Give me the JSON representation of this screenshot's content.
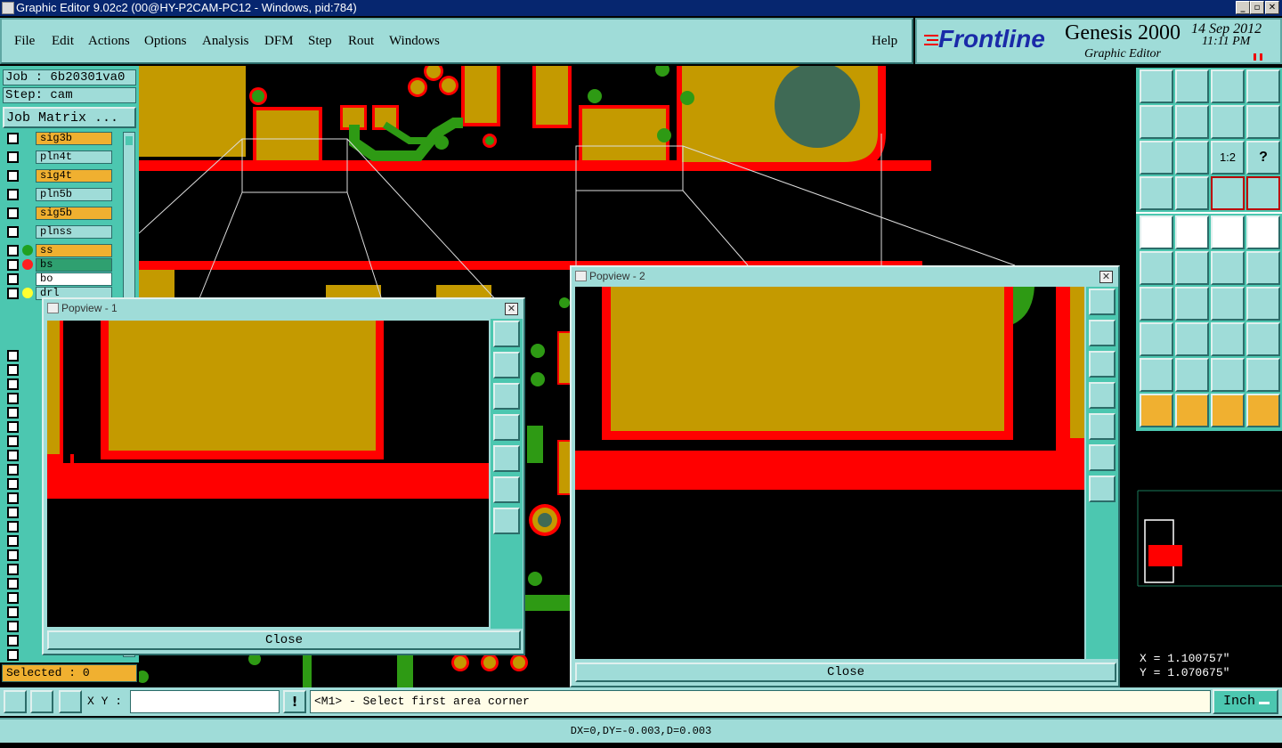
{
  "window": {
    "title": "Graphic Editor 9.02c2 (00@HY-P2CAM-PC12 - Windows, pid:784)"
  },
  "menu": {
    "items": [
      "File",
      "Edit",
      "Actions",
      "Options",
      "Analysis",
      "DFM",
      "Step",
      "Rout",
      "Windows"
    ],
    "help": "Help"
  },
  "brand": {
    "logo": "Frontline",
    "product": "Genesis 2000",
    "subtitle": "Graphic Editor",
    "date": "14 Sep 2012",
    "time": "11:11 PM"
  },
  "job": {
    "job_line": "Job : 6b20301va0",
    "step_line": "Step: cam",
    "matrix_button": "Job Matrix ..."
  },
  "layers": [
    {
      "name": "sig3b",
      "color": "#f0b030",
      "dot": ""
    },
    {
      "name": "pln4t",
      "color": "#9fdcd8",
      "dot": ""
    },
    {
      "name": "sig4t",
      "color": "#f0b030",
      "dot": ""
    },
    {
      "name": "pln5b",
      "color": "#9fdcd8",
      "dot": ""
    },
    {
      "name": "sig5b",
      "color": "#f0b030",
      "dot": ""
    },
    {
      "name": "plnss",
      "color": "#9fdcd8",
      "dot": ""
    },
    {
      "name": "ss",
      "color": "#f0b030",
      "dot": "#1fa020"
    },
    {
      "name": "bs",
      "color": "#2fa070",
      "dot": "#ff2020"
    },
    {
      "name": "bo",
      "color": "#ffffff",
      "dot": ""
    },
    {
      "name": "drl",
      "color": "#9fdcd8",
      "dot": "#ffff30"
    }
  ],
  "selected": "Selected : 0",
  "popview1": {
    "title": "Popview - 1",
    "close_label": "Close",
    "close_x": "✕"
  },
  "popview2": {
    "title": "Popview - 2",
    "close_label": "Close",
    "close_x": "✕"
  },
  "toolbox": {
    "one_to_two": "1:2",
    "help_q": "?"
  },
  "coords": {
    "x": "X = 1.100757\"",
    "y": "Y = 1.070675\""
  },
  "command": {
    "xy_label": "X Y :",
    "xy_value": "",
    "prompt": "<M1> - Select first area corner",
    "units": "Inch"
  },
  "status": {
    "text": "DX=0,DY=-0.003,D=0.003"
  },
  "colors": {
    "copper": "#c49a00",
    "mask": "#ff0000",
    "trace": "#2e9a14",
    "panel": "#4cc7b0",
    "menu": "#9fdcd8"
  }
}
